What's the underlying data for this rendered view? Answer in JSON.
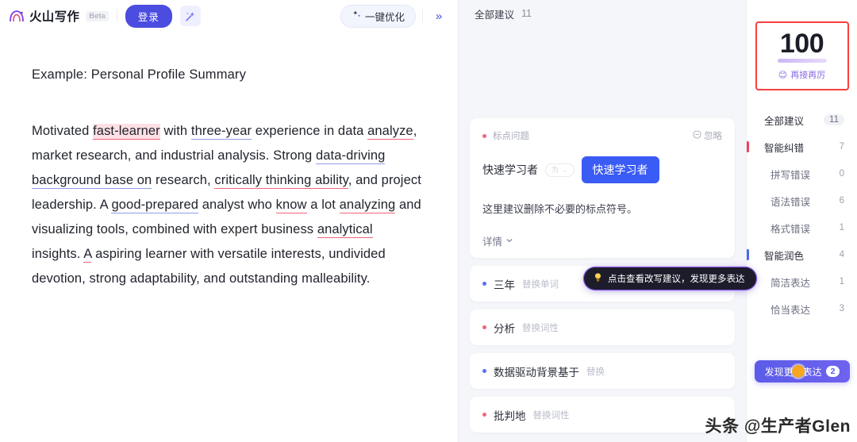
{
  "header": {
    "brand_name": "火山写作",
    "beta_badge": "Beta",
    "login_label": "登录",
    "magic_icon": "magic-wand-icon",
    "optimize_label": "一键优化",
    "optimize_icon": "sparkle-icon",
    "collapse_icon": "double-chevron-right-icon",
    "collapse_label": "»"
  },
  "document": {
    "title": "Example: Personal Profile Summary",
    "paragraph_segments": [
      {
        "text": "Motivated ",
        "mark": "none"
      },
      {
        "text": "fast-learner",
        "mark": "red-fill"
      },
      {
        "text": " with ",
        "mark": "none"
      },
      {
        "text": "three-year",
        "mark": "blue"
      },
      {
        "text": " experience in data ",
        "mark": "none"
      },
      {
        "text": "analyze",
        "mark": "red"
      },
      {
        "text": ", market research, and industrial analysis. Strong ",
        "mark": "none"
      },
      {
        "text": "data-driving background base on",
        "mark": "blue"
      },
      {
        "text": " research, ",
        "mark": "none"
      },
      {
        "text": "critically thinking ability",
        "mark": "red"
      },
      {
        "text": ", and project leadership. A ",
        "mark": "none"
      },
      {
        "text": "good-prepared",
        "mark": "blue"
      },
      {
        "text": " analyst who ",
        "mark": "none"
      },
      {
        "text": "know",
        "mark": "red"
      },
      {
        "text": " a lot ",
        "mark": "none"
      },
      {
        "text": "analyzing",
        "mark": "red"
      },
      {
        "text": " and visualizing tools, combined with expert business ",
        "mark": "none"
      },
      {
        "text": "analytical",
        "mark": "red"
      },
      {
        "text": " insights. ",
        "mark": "none"
      },
      {
        "text": "A",
        "mark": "red"
      },
      {
        "text": " aspiring learner with versatile interests, undivided devotion, strong adaptability, and outstanding malleability.",
        "mark": "none"
      }
    ]
  },
  "suggestions": {
    "head_title": "全部建议",
    "head_count": "11",
    "card": {
      "type_label": "标点问题",
      "ignore_label": "忽略",
      "ignore_icon": "minus-circle-icon",
      "original_text": "快速学习者",
      "arrow_pill": "为 →",
      "replacement_text": "快速学习者",
      "description": "这里建议删除不必要的标点符号。",
      "detail_label": "详情",
      "detail_icon": "chevron-down-icon"
    },
    "rows": [
      {
        "dot": "blue",
        "text": "三年",
        "tag": "替换单词"
      },
      {
        "dot": "red",
        "text": "分析",
        "tag": "替换词性"
      },
      {
        "dot": "blue",
        "text": "数据驱动背景基于",
        "tag": "替换"
      },
      {
        "dot": "red",
        "text": "批判地",
        "tag": "替换词性"
      }
    ],
    "tooltip": {
      "icon": "lightbulb-icon",
      "text": "点击查看改写建议，发现更多表达"
    }
  },
  "sidebar": {
    "score": "100",
    "score_label": "再接再厉",
    "score_emoji": "😊",
    "categories": [
      {
        "label": "全部建议",
        "count": "11",
        "bar": "none",
        "style": "header",
        "pill": true
      },
      {
        "label": "智能纠错",
        "count": "7",
        "bar": "red",
        "style": "header",
        "pill": false
      },
      {
        "label": "拼写错误",
        "count": "0",
        "bar": "none",
        "style": "sub",
        "pill": false
      },
      {
        "label": "语法错误",
        "count": "6",
        "bar": "none",
        "style": "sub",
        "pill": false
      },
      {
        "label": "格式错误",
        "count": "1",
        "bar": "none",
        "style": "sub",
        "pill": false
      },
      {
        "label": "智能润色",
        "count": "4",
        "bar": "blue",
        "style": "header",
        "pill": false
      },
      {
        "label": "简洁表达",
        "count": "1",
        "bar": "none",
        "style": "sub",
        "pill": false
      },
      {
        "label": "恰当表达",
        "count": "3",
        "bar": "none",
        "style": "sub",
        "pill": false
      }
    ],
    "discover_label": "发现更多表达",
    "discover_count": "2"
  },
  "watermark": "头条 @生产者Glen",
  "colors": {
    "accent": "#4b4ce0",
    "error_red": "#f2657a",
    "polish_blue": "#5b6ef0",
    "score_border": "#f83f3f",
    "replace_blue": "#3b5bf5"
  }
}
